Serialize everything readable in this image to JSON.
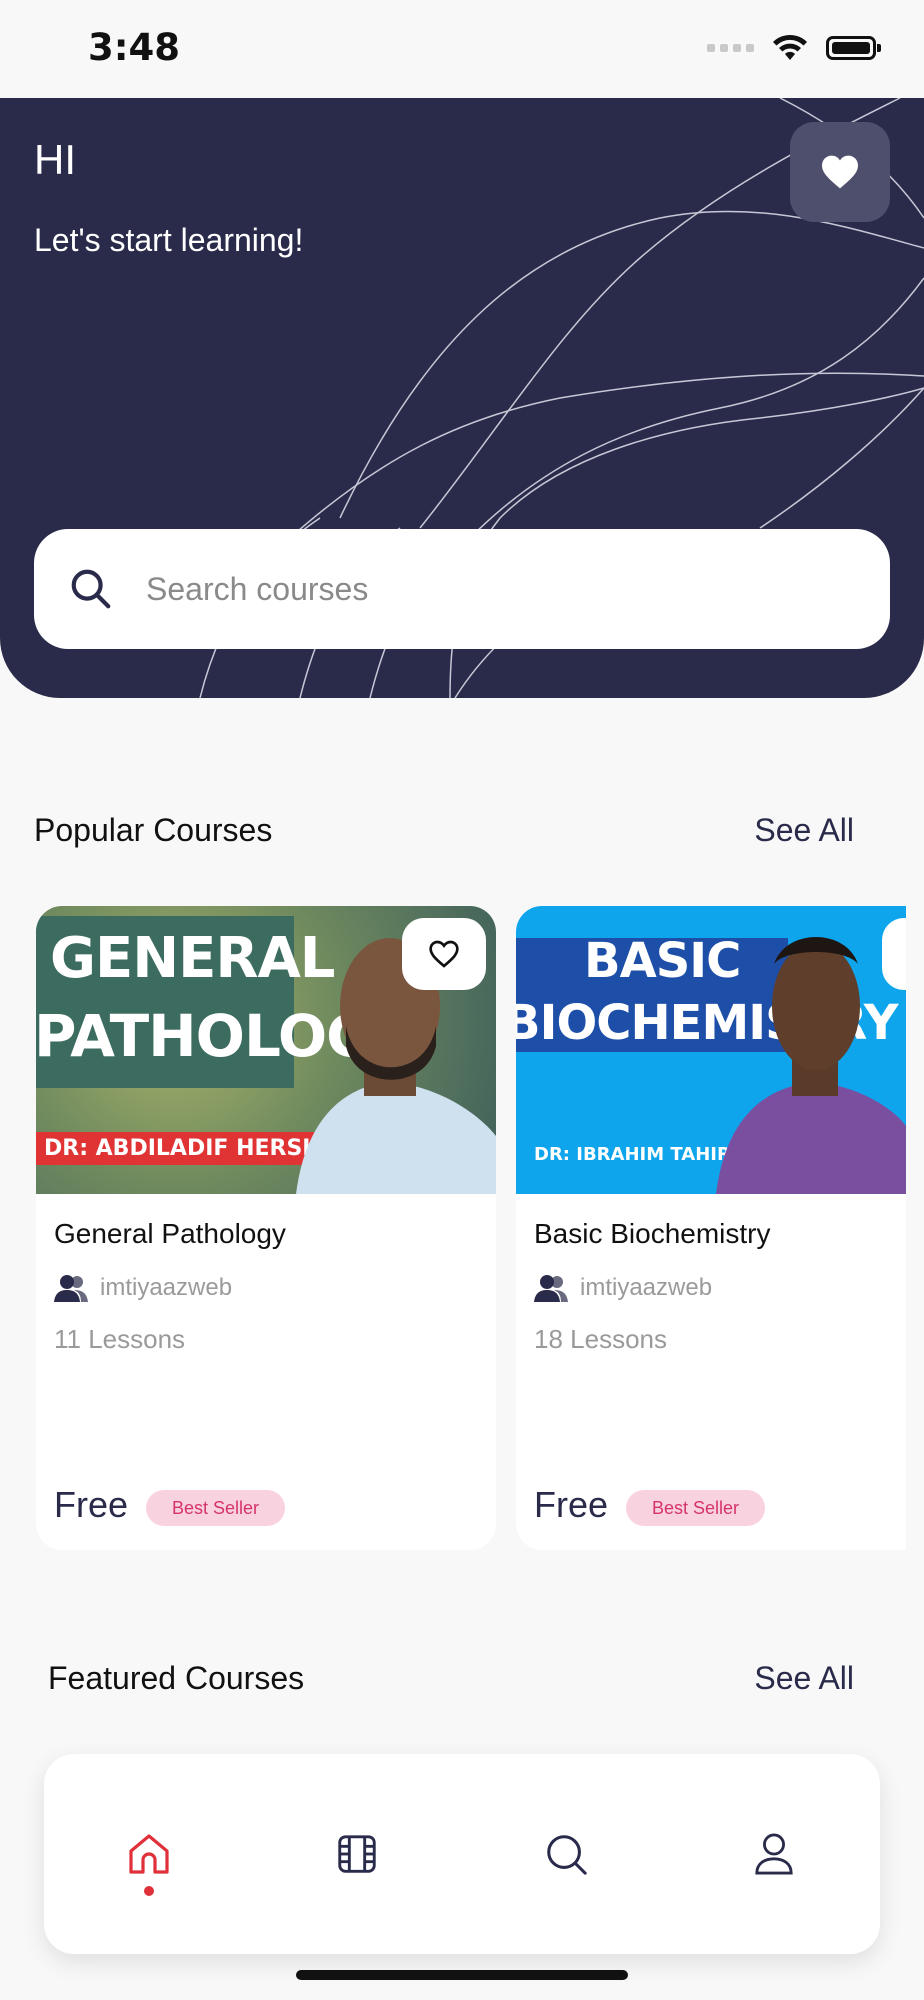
{
  "status_bar": {
    "time": "3:48"
  },
  "header": {
    "greeting": "HI",
    "subtitle": "Let's start learning!",
    "favorites_icon": "heart-icon"
  },
  "search": {
    "placeholder": "Search courses",
    "icon": "search-icon"
  },
  "popular": {
    "title": "Popular Courses",
    "see_all": "See All",
    "courses": [
      {
        "thumb_title_line1": "GENERAL",
        "thumb_title_line2": "PATHOLOGY",
        "thumb_doctor": "DR: ABDILADIF HERSI",
        "title": "General Pathology",
        "author": "imtiyaazweb",
        "lessons": "11 Lessons",
        "price": "Free",
        "badge": "Best Seller"
      },
      {
        "thumb_title_line1": "BASIC",
        "thumb_title_line2": "BIOCHEMISTRY",
        "thumb_doctor": "DR: IBRAHIM TAHIR",
        "title": "Basic Biochemistry",
        "author": "imtiyaazweb",
        "lessons": "18 Lessons",
        "price": "Free",
        "badge": "Best Seller"
      }
    ]
  },
  "featured": {
    "title": "Featured Courses",
    "see_all": "See All"
  },
  "bottom_nav": {
    "items": [
      "home-icon",
      "film-icon",
      "search-icon",
      "profile-icon"
    ],
    "active_index": 0,
    "active_color": "#e0303a"
  },
  "colors": {
    "primary_dark": "#2a2b4a",
    "badge_bg": "#f8d3df",
    "badge_text": "#d6336c"
  }
}
